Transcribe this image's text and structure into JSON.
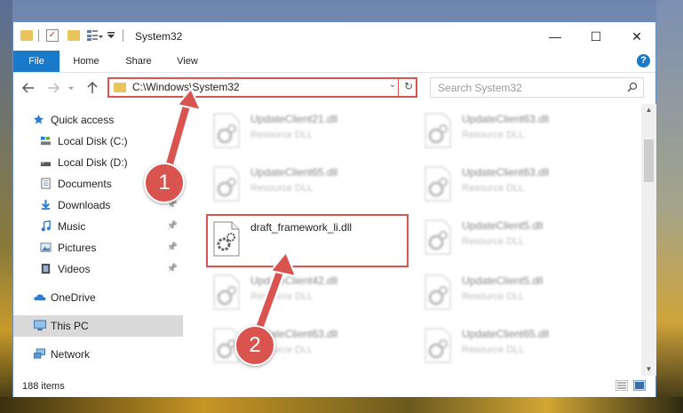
{
  "window": {
    "title": "System32",
    "controls": {
      "minimize": "—",
      "maximize": "☐",
      "close": "✕"
    }
  },
  "ribbon": {
    "tabs": [
      {
        "label": "File"
      },
      {
        "label": "Home"
      },
      {
        "label": "Share"
      },
      {
        "label": "View"
      }
    ],
    "help_label": "?"
  },
  "address": {
    "path": "C:\\Windows\\System32",
    "search_placeholder": "Search System32"
  },
  "nav": [
    {
      "label": "Quick access",
      "icon": "star-icon",
      "pinned": false
    },
    {
      "label": "Local Disk (C:)",
      "icon": "drive-icon",
      "pinned": false
    },
    {
      "label": "Local Disk (D:)",
      "icon": "drive-icon",
      "pinned": false
    },
    {
      "label": "Documents",
      "icon": "document-icon",
      "pinned": false
    },
    {
      "label": "Downloads",
      "icon": "download-icon",
      "pinned": true
    },
    {
      "label": "Music",
      "icon": "music-icon",
      "pinned": true
    },
    {
      "label": "Pictures",
      "icon": "picture-icon",
      "pinned": true
    },
    {
      "label": "Videos",
      "icon": "video-icon",
      "pinned": true
    },
    {
      "label": "OneDrive",
      "icon": "cloud-icon",
      "pinned": false
    },
    {
      "label": "This PC",
      "icon": "computer-icon",
      "pinned": false,
      "selected": true
    },
    {
      "label": "Network",
      "icon": "network-icon",
      "pinned": false
    }
  ],
  "pin_glyph": "📌",
  "files": [
    {
      "name": "UpdateClient21.dll",
      "type": "Resource DLL",
      "blurred": true
    },
    {
      "name": "UpdateClient63.dll",
      "type": "Resource DLL",
      "blurred": true
    },
    {
      "name": "UpdateClient65.dll",
      "type": "Resource DLL",
      "blurred": true
    },
    {
      "name": "UpdateClient63.dll",
      "type": "Resource DLL",
      "blurred": true
    },
    {
      "name": "draft_framework_li.dll",
      "type": "",
      "blurred": false,
      "highlighted": true
    },
    {
      "name": "UpdateClient5.dll",
      "type": "Resource DLL",
      "blurred": true
    },
    {
      "name": "UpdateClient42.dll",
      "type": "Resource DLL",
      "blurred": true
    },
    {
      "name": "UpdateClient5.dll",
      "type": "Resource DLL",
      "blurred": true
    },
    {
      "name": "UpdateClient63.dll",
      "type": "Resource DLL",
      "blurred": true
    },
    {
      "name": "UpdateClient65.dll",
      "type": "Resource DLL",
      "blurred": true
    }
  ],
  "status": {
    "item_count": "188 items"
  },
  "annotations": {
    "step1": "1",
    "step2": "2"
  },
  "colors": {
    "accent": "#1979ca",
    "annotation": "#d9534f"
  }
}
